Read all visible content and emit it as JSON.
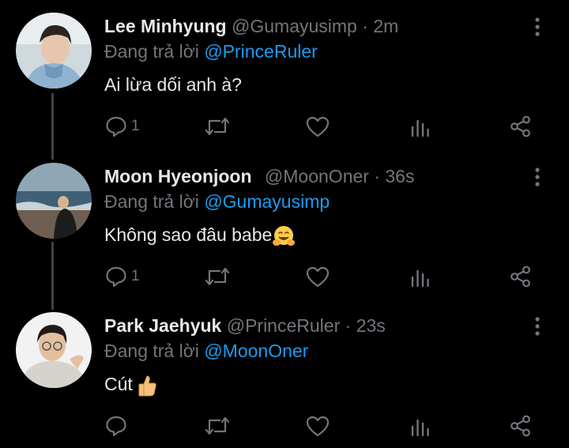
{
  "tweets": [
    {
      "name": "Lee Minhyung",
      "handle": "@Gumayusimp",
      "sep": "·",
      "time": "2m",
      "reply_prefix": "Đang trả lời",
      "reply_to": "@PrinceRuler",
      "text": "Ai lừa dối anh à?",
      "reply_count": "1",
      "emoji": ""
    },
    {
      "name": "Moon Hyeonjoon",
      "handle": "@MoonOner",
      "sep": "·",
      "time": "36s",
      "reply_prefix": "Đang trả lời",
      "reply_to": "@Gumayusimp",
      "text": "Không sao đâu babe",
      "reply_count": "1",
      "emoji": "hugging-face"
    },
    {
      "name": "Park Jaehyuk",
      "handle": "@PrinceRuler",
      "sep": "·",
      "time": "23s",
      "reply_prefix": "Đang trả lời",
      "reply_to": "@MoonOner",
      "text": "Cút",
      "reply_count": "",
      "emoji": "thumbs-up"
    }
  ],
  "icons": [
    "reply-icon",
    "retweet-icon",
    "like-icon",
    "analytics-icon",
    "share-icon",
    "more-icon"
  ],
  "colors": {
    "background": "#000000",
    "name": "#e7e9ea",
    "muted": "#71767b",
    "mention": "#1d9bf0",
    "thread_line": "#3d4349"
  }
}
